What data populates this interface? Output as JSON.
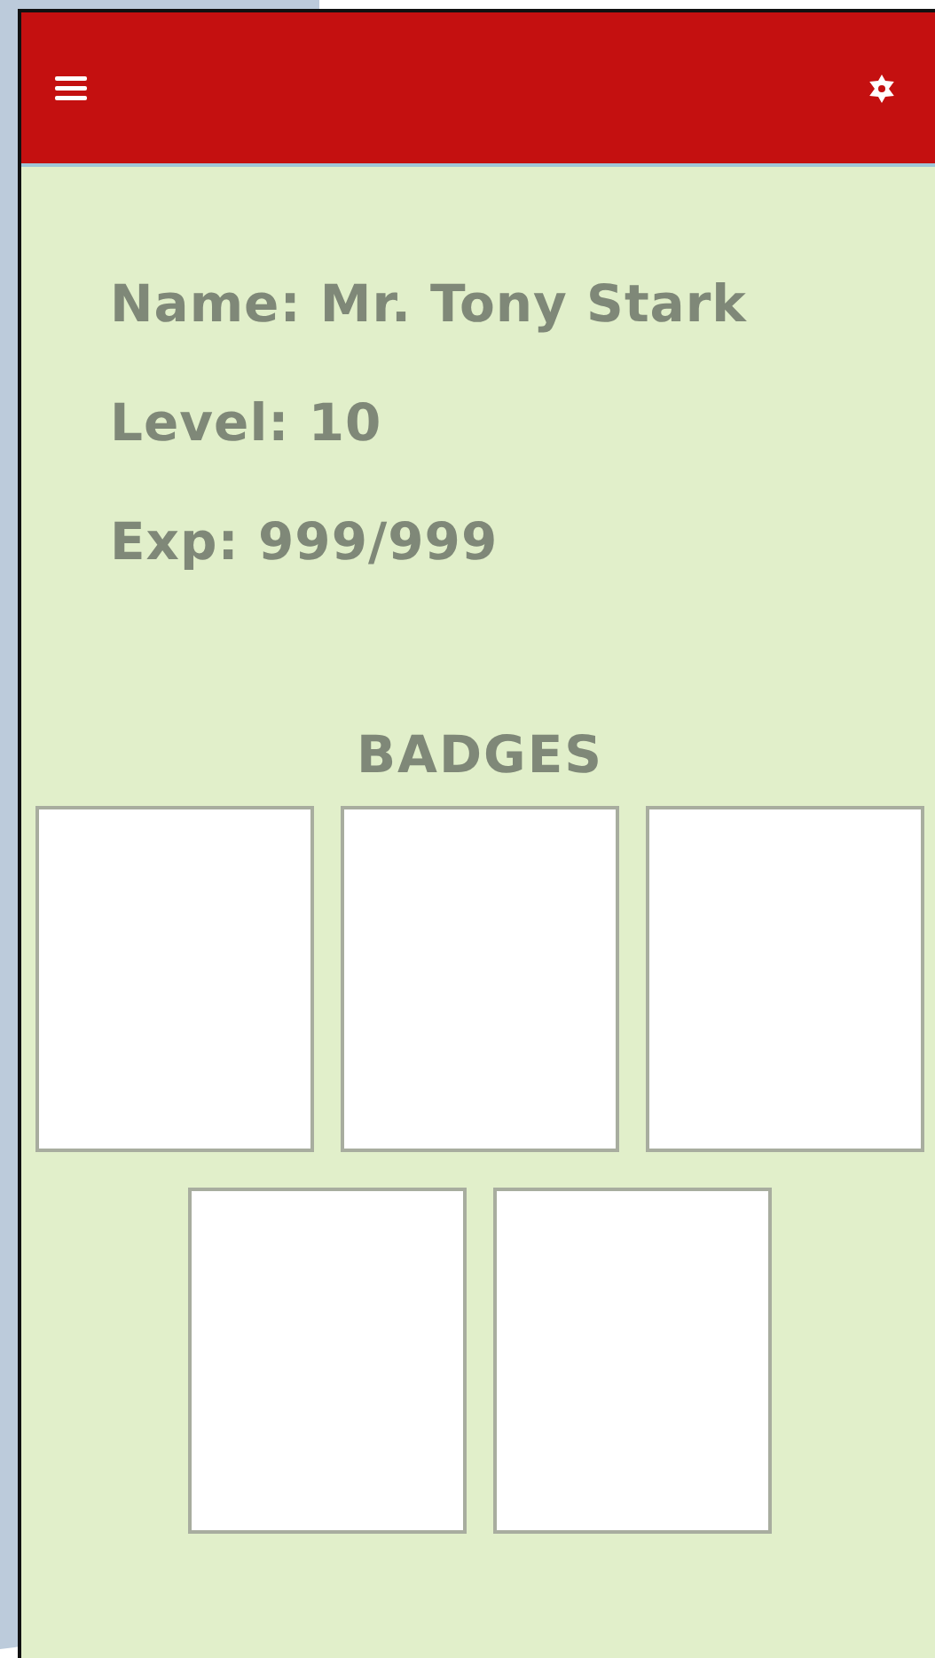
{
  "profile": {
    "fields": [
      "Name: Mr. Tony Stark",
      "Level: 10",
      "Exp: 999/999"
    ]
  },
  "badges": {
    "title": "BADGES",
    "slots": [
      {
        "kind": "empty"
      },
      {
        "kind": "empty"
      },
      {
        "kind": "empty"
      },
      {
        "kind": "empty"
      },
      {
        "kind": "empty"
      }
    ]
  }
}
